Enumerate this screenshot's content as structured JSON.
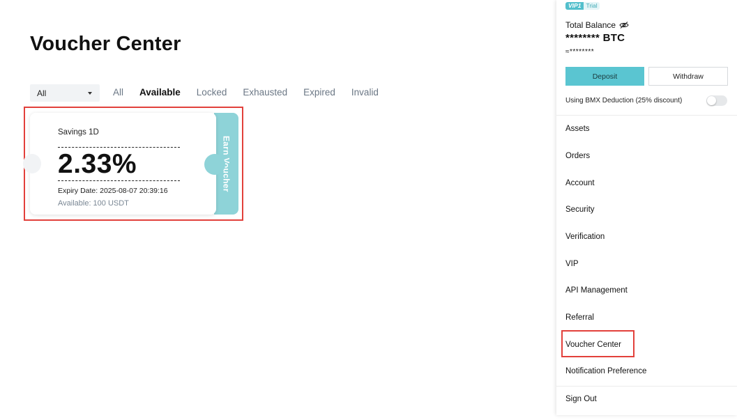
{
  "page": {
    "title": "Voucher Center"
  },
  "filter": {
    "selected": "All",
    "tabs": [
      "All",
      "Available",
      "Locked",
      "Exhausted",
      "Expired",
      "Invalid"
    ],
    "active_tab": "Available"
  },
  "voucher": {
    "name": "Savings 1D",
    "rate": "2.33%",
    "expiry": "Expiry Date: 2025-08-07 20:39:16",
    "available": "Available: 100 USDT",
    "action_label": "Earn Voucher",
    "accent_color": "#8ed3d8"
  },
  "account_panel": {
    "vip_badge": "VIP1",
    "vip_trial": "Trial",
    "balance_label": "Total Balance",
    "balance_value": "******** BTC",
    "balance_approx": "≈********",
    "deposit_label": "Deposit",
    "withdraw_label": "Withdraw",
    "bmx_label": "Using BMX Deduction (25% discount)",
    "bmx_enabled": false,
    "menu": [
      {
        "label": "Assets"
      },
      {
        "label": "Orders"
      },
      {
        "label": "Account"
      },
      {
        "label": "Security"
      },
      {
        "label": "Verification"
      },
      {
        "label": "VIP"
      },
      {
        "label": "API Management"
      },
      {
        "label": "Referral"
      },
      {
        "label": "Voucher Center"
      },
      {
        "label": "Notification Preference"
      }
    ],
    "sign_out_label": "Sign Out",
    "icons": {
      "hide_balance": "eye-off-icon",
      "dropdown": "caret-down-icon"
    },
    "accent_color": "#5ac5d1",
    "annotation_color": "#e2403b"
  }
}
